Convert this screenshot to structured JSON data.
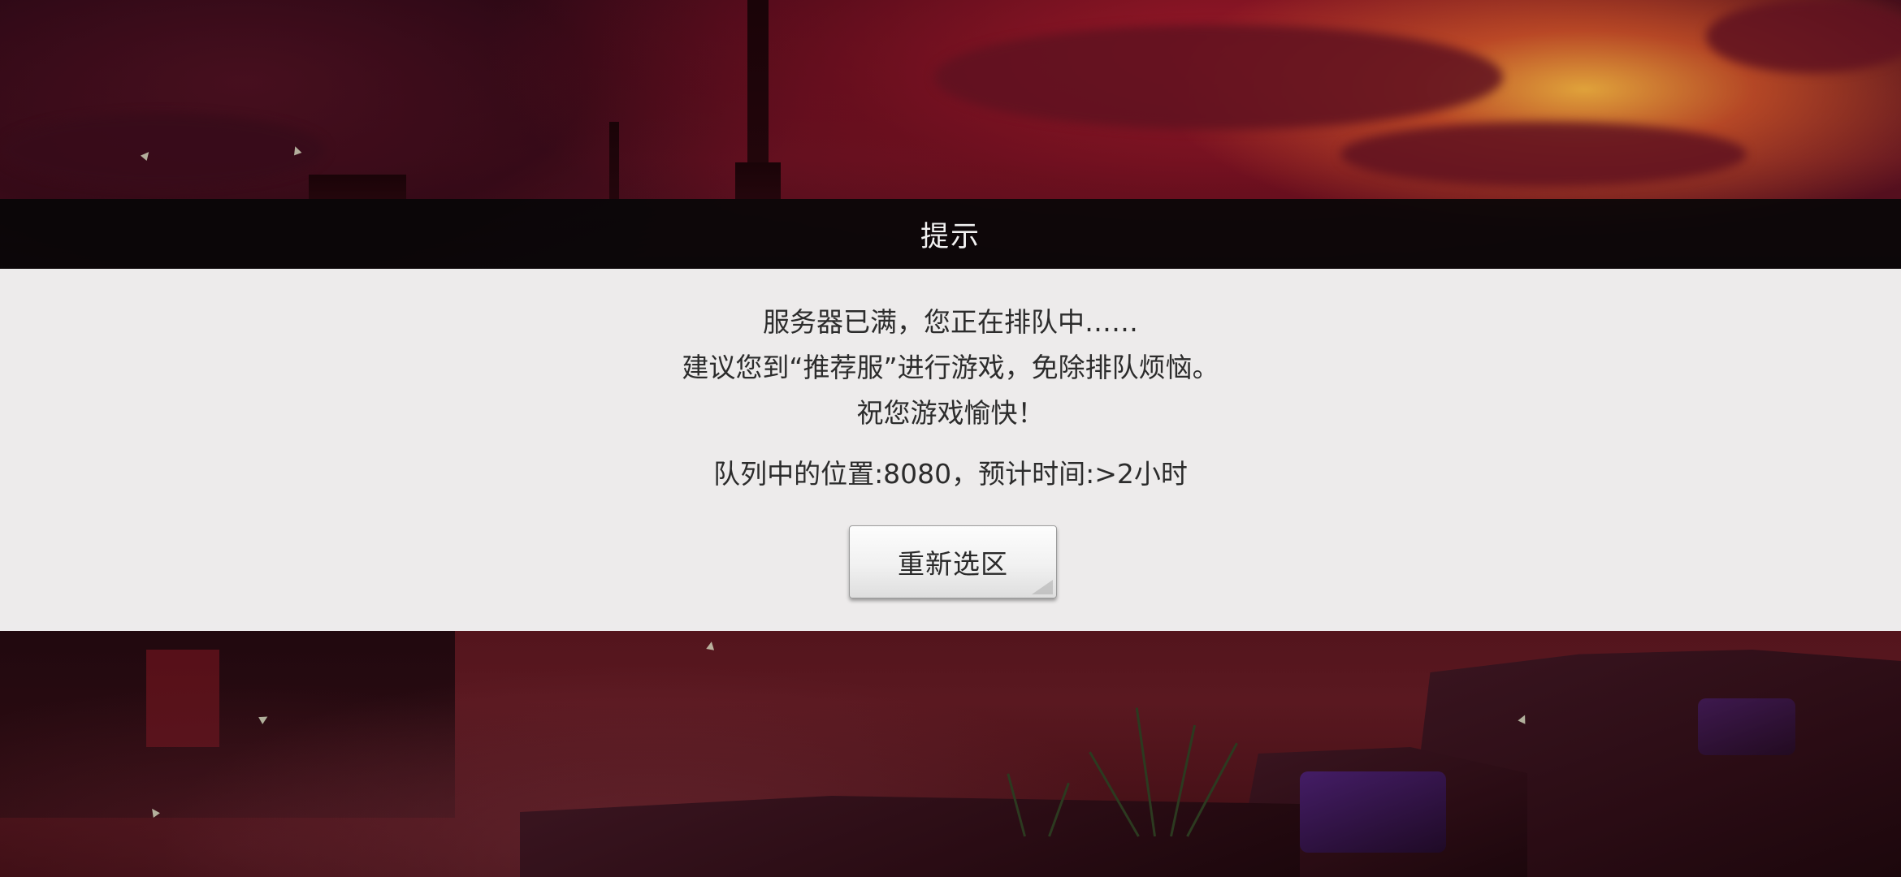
{
  "dialog": {
    "title": "提示",
    "messages": [
      "服务器已满，您正在排队中……",
      "建议您到“推荐服”进行游戏，免除排队烦恼。",
      "祝您游戏愉快！"
    ],
    "queue_status": "队列中的位置:8080，预计时间:>2小时",
    "reselect_button_label": "重新选区"
  },
  "colors": {
    "header_bar": "#080608",
    "body_panel": "#f3f3f3",
    "text": "#2c2c2c",
    "title_text": "#f2f2f2"
  }
}
